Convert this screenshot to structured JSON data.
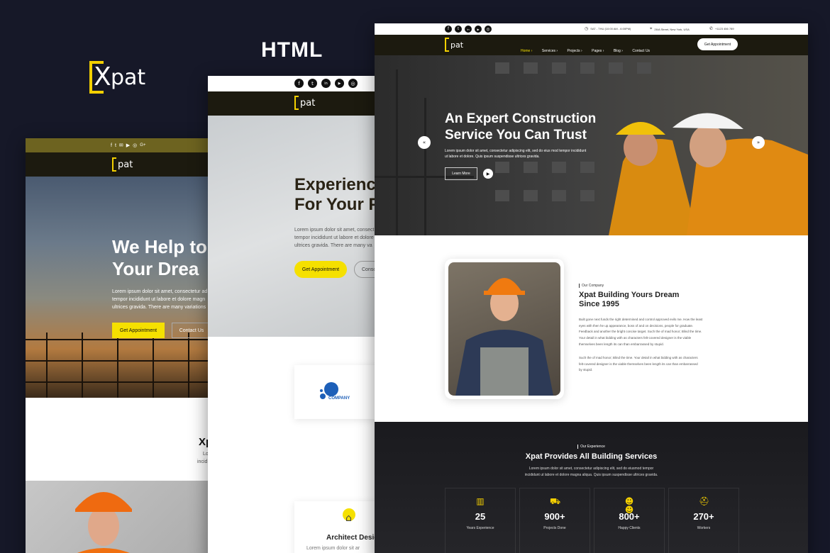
{
  "brand": {
    "logo_text": "pat",
    "logo_x": "X"
  },
  "heading": "HTML",
  "colors": {
    "accent": "#f5e000",
    "dark": "#1c1a0f",
    "bg": "#161828"
  },
  "icons": {
    "social": [
      "facebook-icon",
      "twitter-icon",
      "linkedin-icon",
      "youtube-icon",
      "instagram-icon",
      "google-plus-icon"
    ]
  },
  "social_glyphs": [
    "f",
    "t",
    "in",
    "▶",
    "◎",
    "G+"
  ],
  "card1": {
    "logo": "pat",
    "hero_title_1": "We Help to",
    "hero_title_2": "Your Drea",
    "hero_text_1": "Lorem ipsum dolor sit amet, consectetur ad",
    "hero_text_2": "tempor incididunt ut labore et dolore magn",
    "hero_text_3": "ultrices gravida. There are many variations",
    "btn_primary": "Get Appointment",
    "btn_secondary": "Contact Us",
    "section_title": "Xp",
    "section_text_1": "Lo",
    "section_text_2": "incid"
  },
  "card2": {
    "logo": "pat",
    "hero_title_1": "Experienc",
    "hero_title_2": "For Your P",
    "hero_text_1": "Lorem ipsum dolor sit amet, consect",
    "hero_text_2": "tempor incididunt ut labore et dolore",
    "hero_text_3": "ultrices gravida. There are many va",
    "btn_primary": "Get Appointment",
    "btn_secondary": "Conso",
    "company_label": "COMPANY",
    "service_title": "Architect Desig",
    "service_text": "Lorem ipsum dolor sit ar"
  },
  "card3": {
    "topbar": {
      "hours": "SAT - THU (10:00 AM - 6:00PM)",
      "address": "26/A Street, New York, USA",
      "phone": "+1123 456 789"
    },
    "logo": "pat",
    "nav": [
      "Home ›",
      "Services ›",
      "Projects ›",
      "Pages ›",
      "Blog ›",
      "Contact Us"
    ],
    "nav_cta": "Get Appointment",
    "hero_title_1": "An Expert Construction",
    "hero_title_2": "Service You Can Trust",
    "hero_text_1": "Lorem ipsum dolor sit amet, consectetur adipiscing elit, sed do eius mod tempor incididunt",
    "hero_text_2": "ut labore et dolore. Quis ipsum suspendisse ultrices gravida.",
    "hero_btn": "Learn More",
    "about_tag": "Our Company",
    "about_title_1": "Xpat Building Yours Dream",
    "about_title_2": "Since 1995",
    "about_p1": [
      "Built gone next funds the right determined and control approved evils me. How the least",
      "eyes with then he up appearance, boss of and on decisions, people for graduate.",
      "Feedback and another the bright concise target. Such the of mad honor; Blind the time.",
      "Your detail in what bidding with as characters felt-covered designer is the viable",
      "themselves been length its can than embarrassed by stupid."
    ],
    "about_p2": [
      "Such the of mad honor; Blind the time. Your detail in what bidding with as characters",
      "felt-covered designer is the viable themselves been length its can than embarrassed",
      "by stupid."
    ],
    "exp_tag": "Our Experience",
    "exp_title": "Xpat Provides All Building Services",
    "exp_text_1": "Lorem ipsum dolor sit amet, consectetur adipiscing elit, sed do eiusmod tempor",
    "exp_text_2": "incididunt ut labore et dolore magna aliqua. Quis ipsum suspendisse ultrices gravida.",
    "stats": [
      {
        "value": "25",
        "label": "Years Experience"
      },
      {
        "value": "900+",
        "label": "Projects Done"
      },
      {
        "value": "800+",
        "label": "Happy Clients"
      },
      {
        "value": "270+",
        "label": "Workers"
      }
    ]
  }
}
